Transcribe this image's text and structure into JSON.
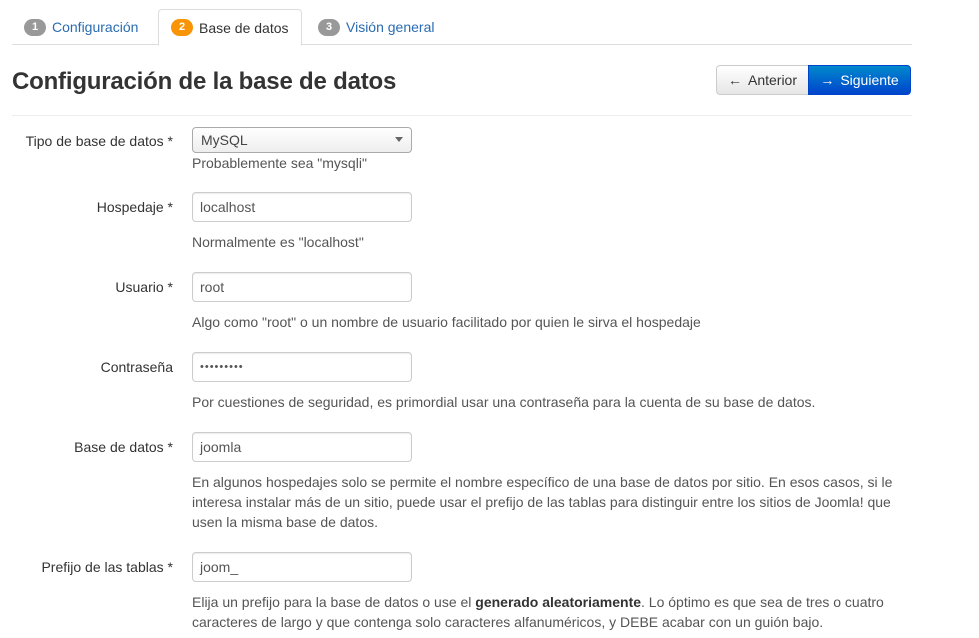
{
  "tabs": [
    {
      "num": "1",
      "label": "Configuración"
    },
    {
      "num": "2",
      "label": "Base de datos"
    },
    {
      "num": "3",
      "label": "Visión general"
    }
  ],
  "page_title": "Configuración de la base de datos",
  "buttons": {
    "prev_label": "Anterior",
    "next_label": "Siguiente"
  },
  "form": {
    "db_type": {
      "label": "Tipo de base de datos *",
      "value": "MySQL",
      "help": "Probablemente sea \"mysqli\""
    },
    "host": {
      "label": "Hospedaje *",
      "value": "localhost",
      "help": "Normalmente es \"localhost\""
    },
    "user": {
      "label": "Usuario *",
      "value": "root",
      "help": "Algo como \"root\" o un nombre de usuario facilitado por quien le sirva el hospedaje"
    },
    "password": {
      "label": "Contraseña",
      "value": "•••••••••",
      "help": "Por cuestiones de seguridad, es primordial usar una contraseña para la cuenta de su base de datos."
    },
    "db_name": {
      "label": "Base de datos *",
      "value": "joomla",
      "help": "En algunos hospedajes solo se permite el nombre específico de una base de datos por sitio. En esos casos, si le interesa instalar más de un sitio, puede usar el prefijo de las tablas para distinguir entre los sitios de Joomla! que usen la misma base de datos."
    },
    "prefix": {
      "label": "Prefijo de las tablas *",
      "value": "joom_",
      "help_part1": "Elija un prefijo para la base de datos o use el ",
      "help_bold": "generado aleatoriamente",
      "help_part2": ". Lo óptimo es que sea de tres o cuatro caracteres de largo y que contenga solo caracteres alfanuméricos, y DEBE acabar con un guión bajo."
    }
  }
}
